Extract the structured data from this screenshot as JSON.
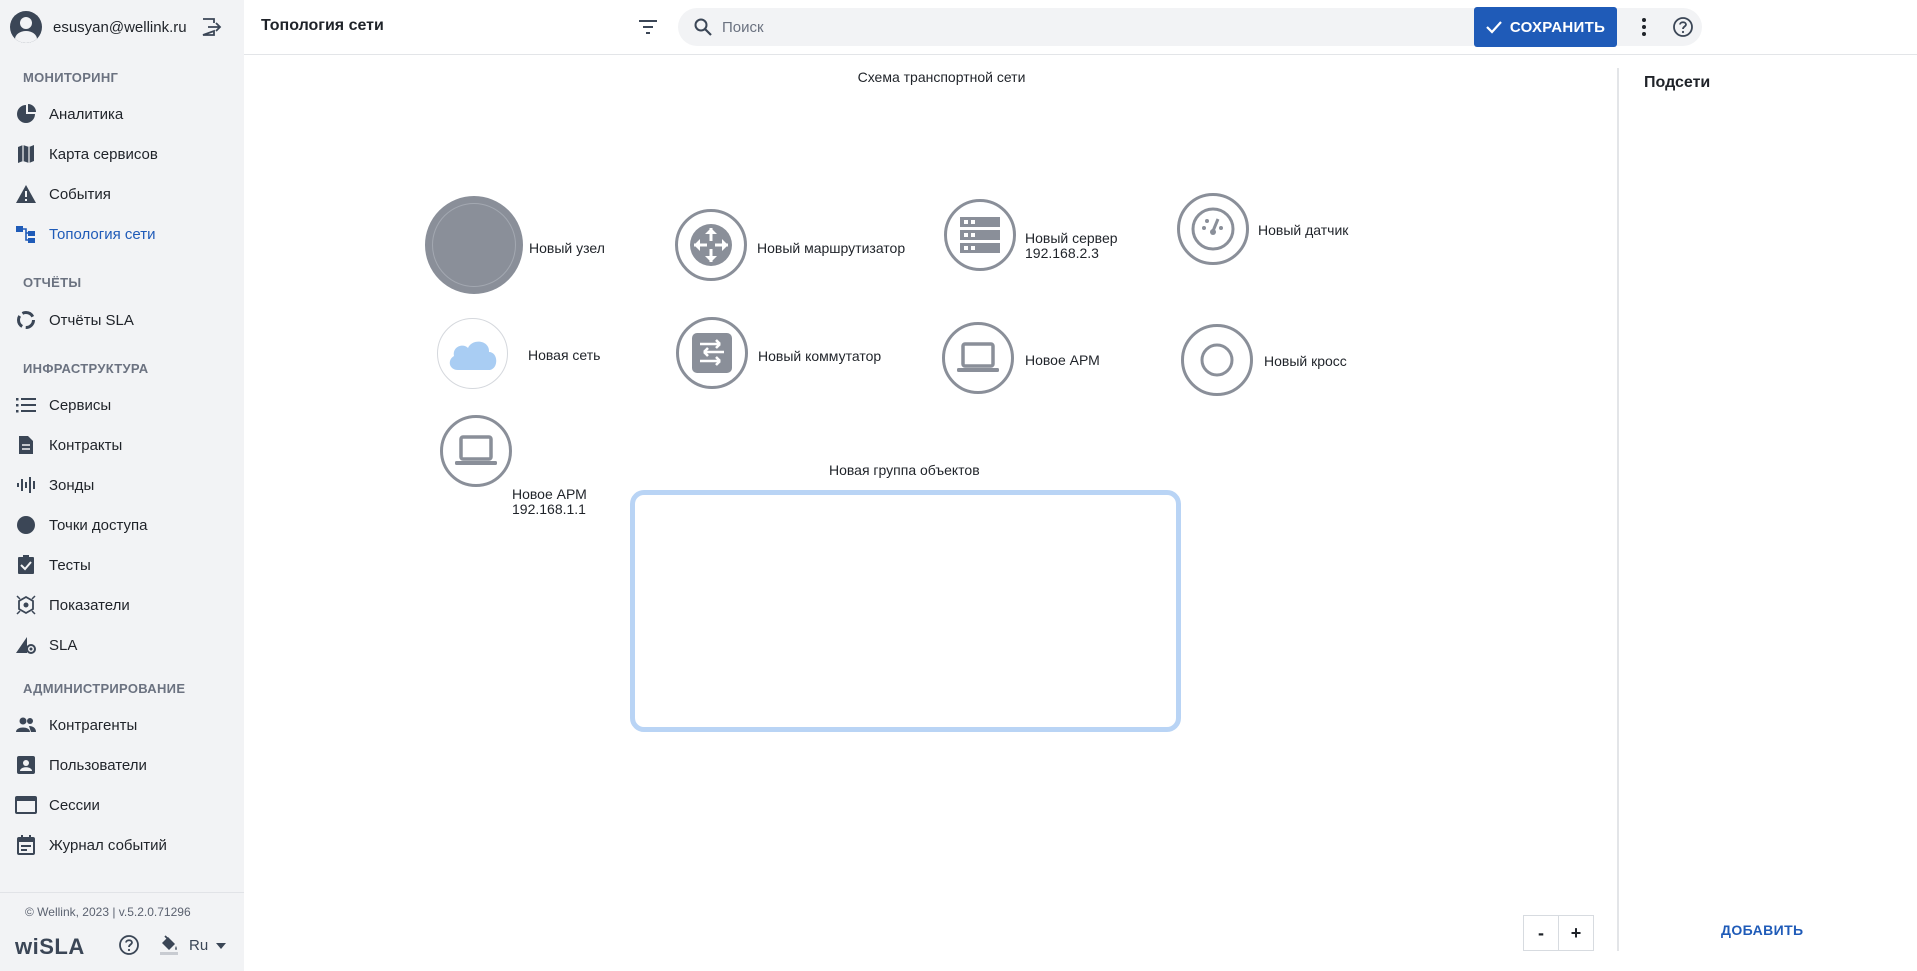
{
  "user": {
    "email": "esusyan@wellink.ru"
  },
  "sidebar": {
    "sections": [
      {
        "title": "МОНИТОРИНГ"
      },
      {
        "title": "ОТЧЁТЫ"
      },
      {
        "title": "ИНФРАСТРУКТУРА"
      },
      {
        "title": "АДМИНИСТРИРОВАНИЕ"
      }
    ],
    "items": [
      {
        "label": "Аналитика",
        "icon": "pie-chart-icon"
      },
      {
        "label": "Карта сервисов",
        "icon": "map-icon"
      },
      {
        "label": "События",
        "icon": "warning-icon"
      },
      {
        "label": "Топология сети",
        "icon": "topology-icon",
        "active": true
      },
      {
        "label": "Отчёты SLA",
        "icon": "circle-progress-icon"
      },
      {
        "label": "Сервисы",
        "icon": "list-icon"
      },
      {
        "label": "Контракты",
        "icon": "document-icon"
      },
      {
        "label": "Зонды",
        "icon": "probe-icon"
      },
      {
        "label": "Точки доступа",
        "icon": "dot-icon"
      },
      {
        "label": "Тесты",
        "icon": "clipboard-check-icon"
      },
      {
        "label": "Показатели",
        "icon": "metrics-icon"
      },
      {
        "label": "SLA",
        "icon": "sla-gear-icon"
      },
      {
        "label": "Контрагенты",
        "icon": "people-icon"
      },
      {
        "label": "Пользователи",
        "icon": "user-card-icon"
      },
      {
        "label": "Сессии",
        "icon": "window-icon"
      },
      {
        "label": "Журнал событий",
        "icon": "calendar-icon"
      }
    ],
    "copyright": "© Wellink, 2023 | v.5.2.0.71296",
    "logo": "wiSLA",
    "language": "Ru"
  },
  "header": {
    "title": "Топология сети",
    "search_placeholder": "Поиск",
    "save_label": "СОХРАНИТЬ"
  },
  "canvas": {
    "title": "Схема транспортной сети",
    "nodes": [
      {
        "label": "Новый узел",
        "icon": "node-icon"
      },
      {
        "label": "Новый маршрутизатор",
        "icon": "router-icon"
      },
      {
        "label": "Новый сервер",
        "sublabel": "192.168.2.3",
        "icon": "server-icon"
      },
      {
        "label": "Новый датчик",
        "icon": "sensor-icon"
      },
      {
        "label": "Новая сеть",
        "icon": "cloud-icon"
      },
      {
        "label": "Новый коммутатор",
        "icon": "switch-icon"
      },
      {
        "label": "Новое АРМ",
        "icon": "laptop-icon"
      },
      {
        "label": "Новый кросс",
        "icon": "cross-icon"
      },
      {
        "label": "Новое АРМ",
        "sublabel": "192.168.1.1",
        "icon": "laptop-icon"
      }
    ],
    "group_label": "Новая группа объектов",
    "zoom_out": "-",
    "zoom_in": "+"
  },
  "right_panel": {
    "title": "Подсети",
    "add_label": "ДОБАВИТЬ"
  },
  "colors": {
    "accent": "#1f5bb8",
    "icon_gray": "#8a8f99",
    "group_border": "#b9d4f5",
    "cloud": "#a9cdf3"
  }
}
